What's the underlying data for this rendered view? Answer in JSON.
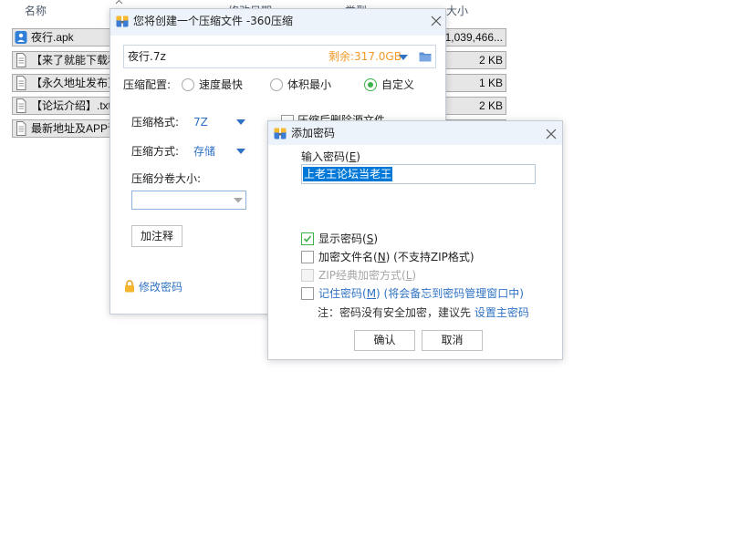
{
  "explorer": {
    "columns": {
      "name": "名称",
      "modified": "修改日期",
      "type": "类型",
      "size": "大小"
    },
    "files": [
      {
        "name": "夜行.apk",
        "size": "1,039,466...",
        "icon": "apk-file-icon",
        "selected": true
      },
      {
        "name": "【来了就能下载和",
        "size": "2 KB",
        "icon": "text-file-icon",
        "selected": true
      },
      {
        "name": "【永久地址发布页",
        "size": "1 KB",
        "icon": "text-file-icon",
        "selected": true
      },
      {
        "name": "【论坛介绍】.txt",
        "size": "2 KB",
        "icon": "text-file-icon",
        "selected": true
      },
      {
        "name": "最新地址及APP请",
        "icon": "text-file-icon",
        "selected": true
      }
    ]
  },
  "compress_dialog": {
    "title": "您将创建一个压缩文件 -360压缩",
    "title_icon": "360-compress-icon",
    "archive_name": "夜行.7z",
    "free_space": "剩余:317.0GB",
    "profile_label": "压缩配置:",
    "profiles": [
      {
        "label": "速度最快",
        "checked": false
      },
      {
        "label": "体积最小",
        "checked": false
      },
      {
        "label": "自定义",
        "checked": true
      }
    ],
    "format_label": "压缩格式:",
    "format_value": "7Z",
    "method_label": "压缩方式:",
    "method_value": "存储",
    "split_label": "压缩分卷大小:",
    "comment_button": "加注释",
    "change_password_link": "修改密码",
    "delete_source_label": "压缩后删除源文件",
    "delete_source_checked": false
  },
  "password_dialog": {
    "title": "添加密码",
    "input_label": "输入密码(E)",
    "password_value": "上老王论坛当老王",
    "options": [
      {
        "label": "显示密码(S)",
        "checked": true,
        "disabled": false
      },
      {
        "label": "加密文件名(N) (不支持ZIP格式)",
        "checked": false,
        "disabled": false
      },
      {
        "label": "ZIP经典加密方式(L)",
        "checked": false,
        "disabled": true
      },
      {
        "label": "记住密码(M) (将会备忘到密码管理窗口中)",
        "checked": false,
        "disabled": false
      }
    ],
    "note": "注：密码没有安全加密，建议先",
    "note_link": "设置主密码",
    "confirm_button": "确认",
    "cancel_button": "取消"
  },
  "colors": {
    "accent_blue": "#2f72c4",
    "free_space_orange": "#f39a2a",
    "check_green": "#3cb34a",
    "selection_blue": "#0078d7"
  }
}
